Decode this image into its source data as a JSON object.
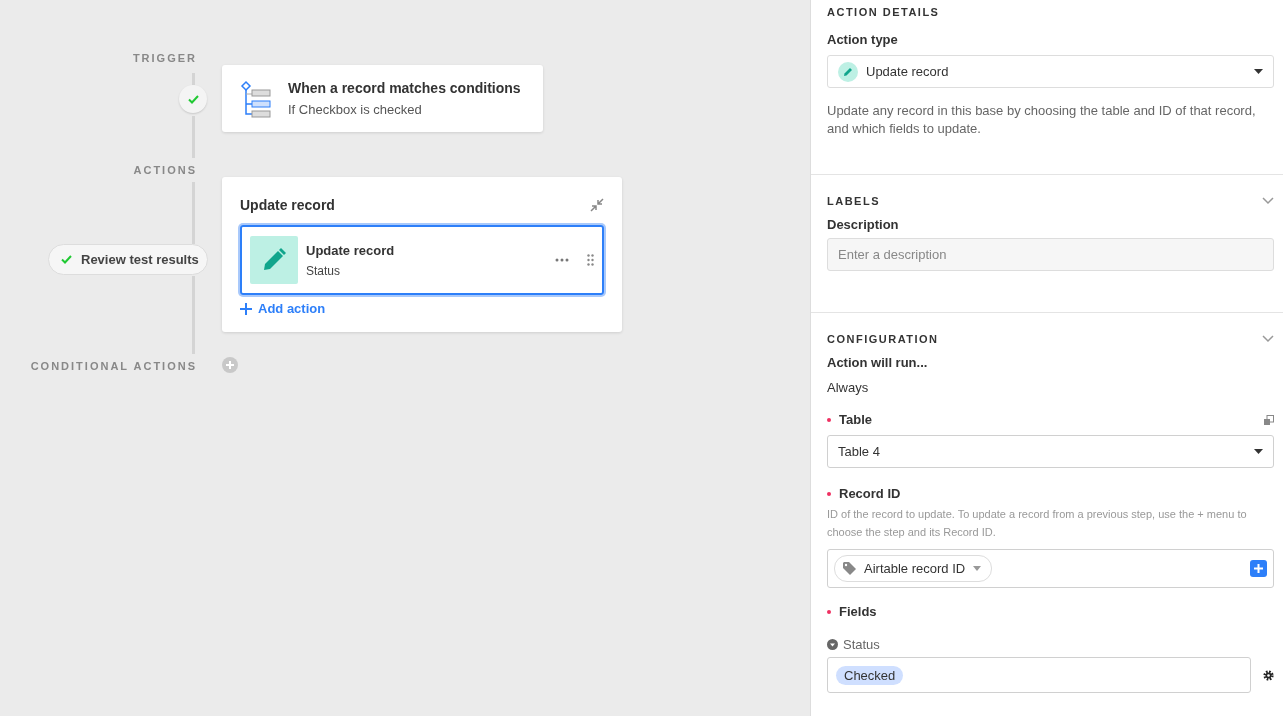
{
  "flow": {
    "trigger_label": "TRIGGER",
    "trigger": {
      "title": "When a record matches conditions",
      "subtitle": "If Checkbox is checked",
      "passed": true
    },
    "actions_label": "ACTIONS",
    "action_group": {
      "title": "Update record",
      "step": {
        "title": "Update record",
        "subtitle": "Status",
        "selected": true
      },
      "add_label": "Add action"
    },
    "test_button": {
      "label": "Review test results",
      "passed": true
    },
    "conditional_label": "CONDITIONAL ACTIONS"
  },
  "panel": {
    "action_details": {
      "heading": "ACTION DETAILS",
      "field_label": "Action type",
      "value": "Update record",
      "help": "Update any record in this base by choosing the table and ID of that record, and which fields to update."
    },
    "labels": {
      "heading": "LABELS",
      "field_label": "Description",
      "placeholder": "Enter a description"
    },
    "configuration": {
      "heading": "CONFIGURATION",
      "run_label": "Action will run...",
      "run_value": "Always",
      "table": {
        "label": "Table",
        "required": true,
        "value": "Table 4"
      },
      "record_id": {
        "label": "Record ID",
        "required": true,
        "help": "ID of the record to update. To update a record from a previous step, use the + menu to choose the step and its Record ID.",
        "token": "Airtable record ID"
      },
      "fields": {
        "label": "Fields",
        "required": true,
        "items": [
          {
            "name": "Status",
            "value": "Checked"
          }
        ]
      }
    }
  }
}
